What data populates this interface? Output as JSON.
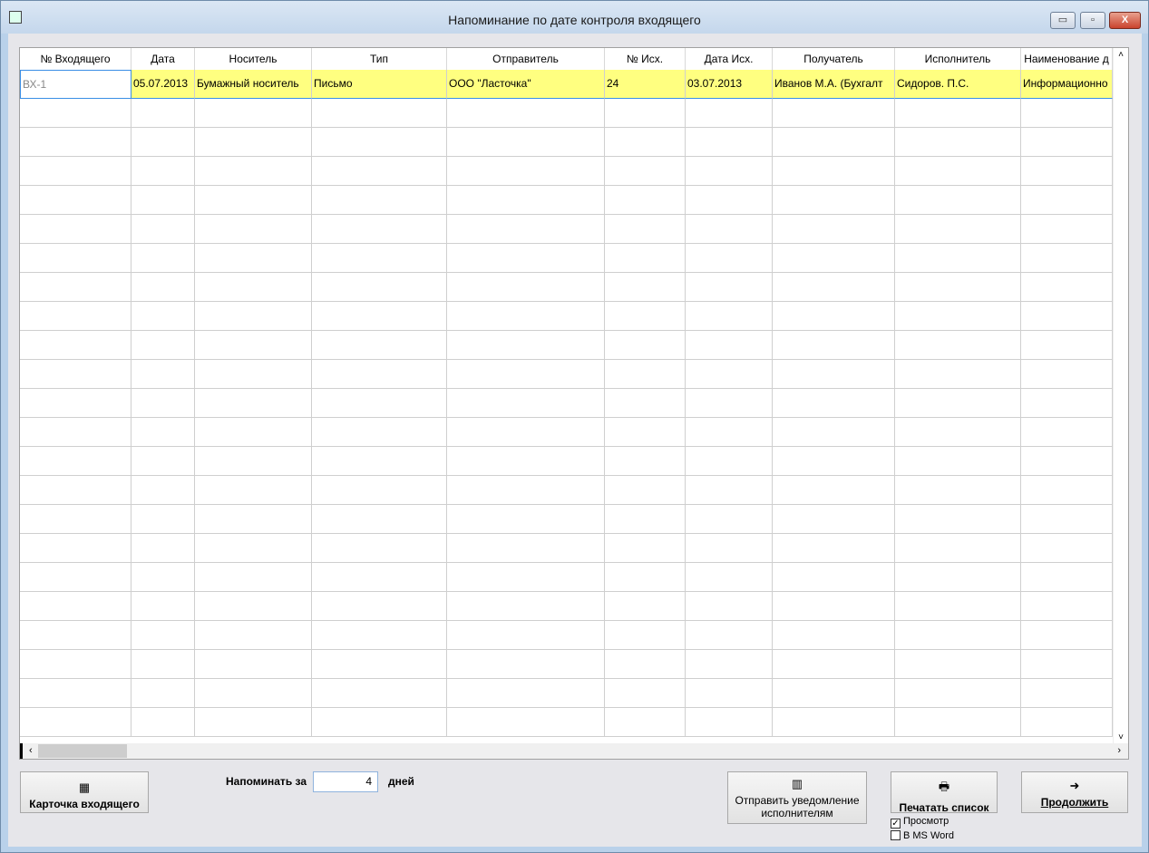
{
  "window": {
    "title": "Напоминание по дате контроля входящего",
    "controls": {
      "minimize": "▭",
      "restore": "▫",
      "close": "X"
    }
  },
  "grid": {
    "columns": [
      "№ Входящего",
      "Дата",
      "Носитель",
      "Тип",
      "Отправитель",
      "№ Исх.",
      "Дата Исх.",
      "Получатель",
      "Исполнитель",
      "Наименование д"
    ],
    "rows": [
      [
        "ВХ-1",
        "05.07.2013",
        "Бумажный носитель",
        "Письмо",
        "ООО \"Ласточка\"",
        "24",
        "03.07.2013",
        "Иванов М.А. (Бухгалт",
        "Сидоров. П.С.",
        "Информационно"
      ]
    ],
    "highlight_color": "#ffff80"
  },
  "footer": {
    "card_button": "Карточка входящего",
    "remind_label": "Напоминать за",
    "remind_value": "4",
    "days_label": "дней",
    "notify_button": "Отправить уведомление исполнителям",
    "print_button": "Печатать список",
    "continue_button": "Продолжить",
    "preview_checkbox": {
      "label": "Просмотр",
      "checked": true
    },
    "msword_checkbox": {
      "label": "В MS Word",
      "checked": false
    }
  }
}
